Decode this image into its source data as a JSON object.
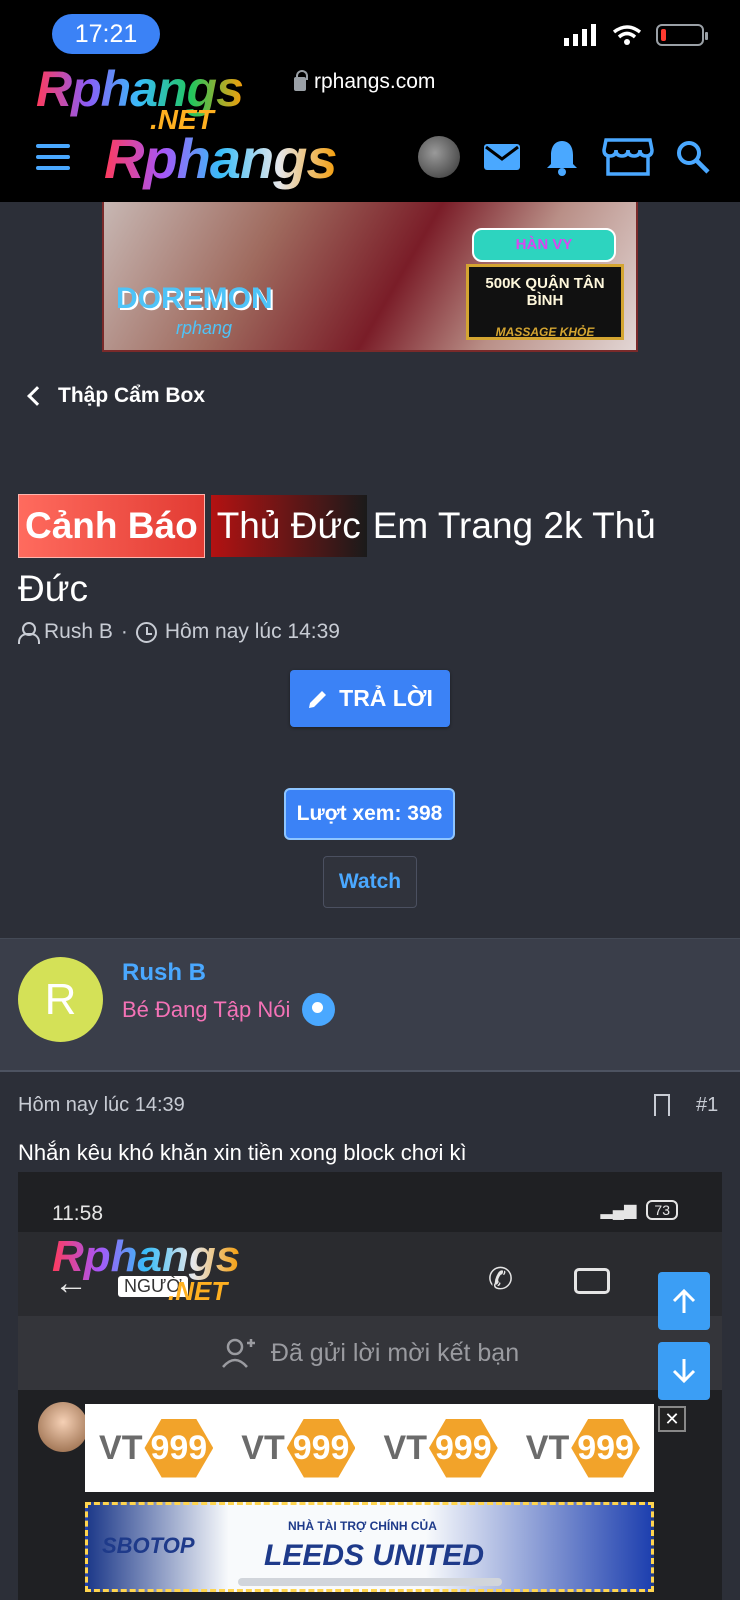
{
  "status_bar": {
    "time": "17:21"
  },
  "browser": {
    "url": "rphangs.com"
  },
  "site": {
    "logo_text": "Rphangs",
    "logo_suffix": ".NET"
  },
  "banner": {
    "brand": "DOREMON",
    "sub": "rphang",
    "tag": "HÀN VY",
    "line1": "500K QUẬN TÂN BÌNH",
    "line2": "MASSAGE KHỎE"
  },
  "breadcrumb": {
    "label": "Thập Cẩm Box"
  },
  "thread": {
    "prefix_warning": "Cảnh Báo",
    "prefix_location": "Thủ Đức",
    "title": "Em Trang 2k Thủ Đức",
    "author": "Rush B",
    "date": "Hôm nay lúc 14:39",
    "reply_label": "TRẢ LỜI",
    "views_label": "Lượt xem: 398",
    "watch_label": "Watch"
  },
  "post": {
    "avatar_letter": "R",
    "username": "Rush B",
    "user_title": "Bé Đang Tập Nói",
    "date": "Hôm nay lúc 14:39",
    "number": "#1",
    "body": "Nhắn kêu khó khăn xin tiền xong block chơi kì"
  },
  "embedded_screenshot": {
    "time": "11:58",
    "battery": "73",
    "name_tag": "NGƯỜ",
    "invite_text": "Đã gửi lời mời kết bạn"
  },
  "ads": {
    "vt_text": "VT",
    "vt_num": "999",
    "sbo_brand": "SBOTOP",
    "sbo_sponsor": "NHÀ TÀI TRỢ CHÍNH CỦA",
    "sbo_team": "LEEDS UNITED"
  },
  "colors": {
    "accent": "#3b82f6",
    "link": "#4aa8ff",
    "user_title": "#f472b6",
    "background": "#2c2f38"
  }
}
